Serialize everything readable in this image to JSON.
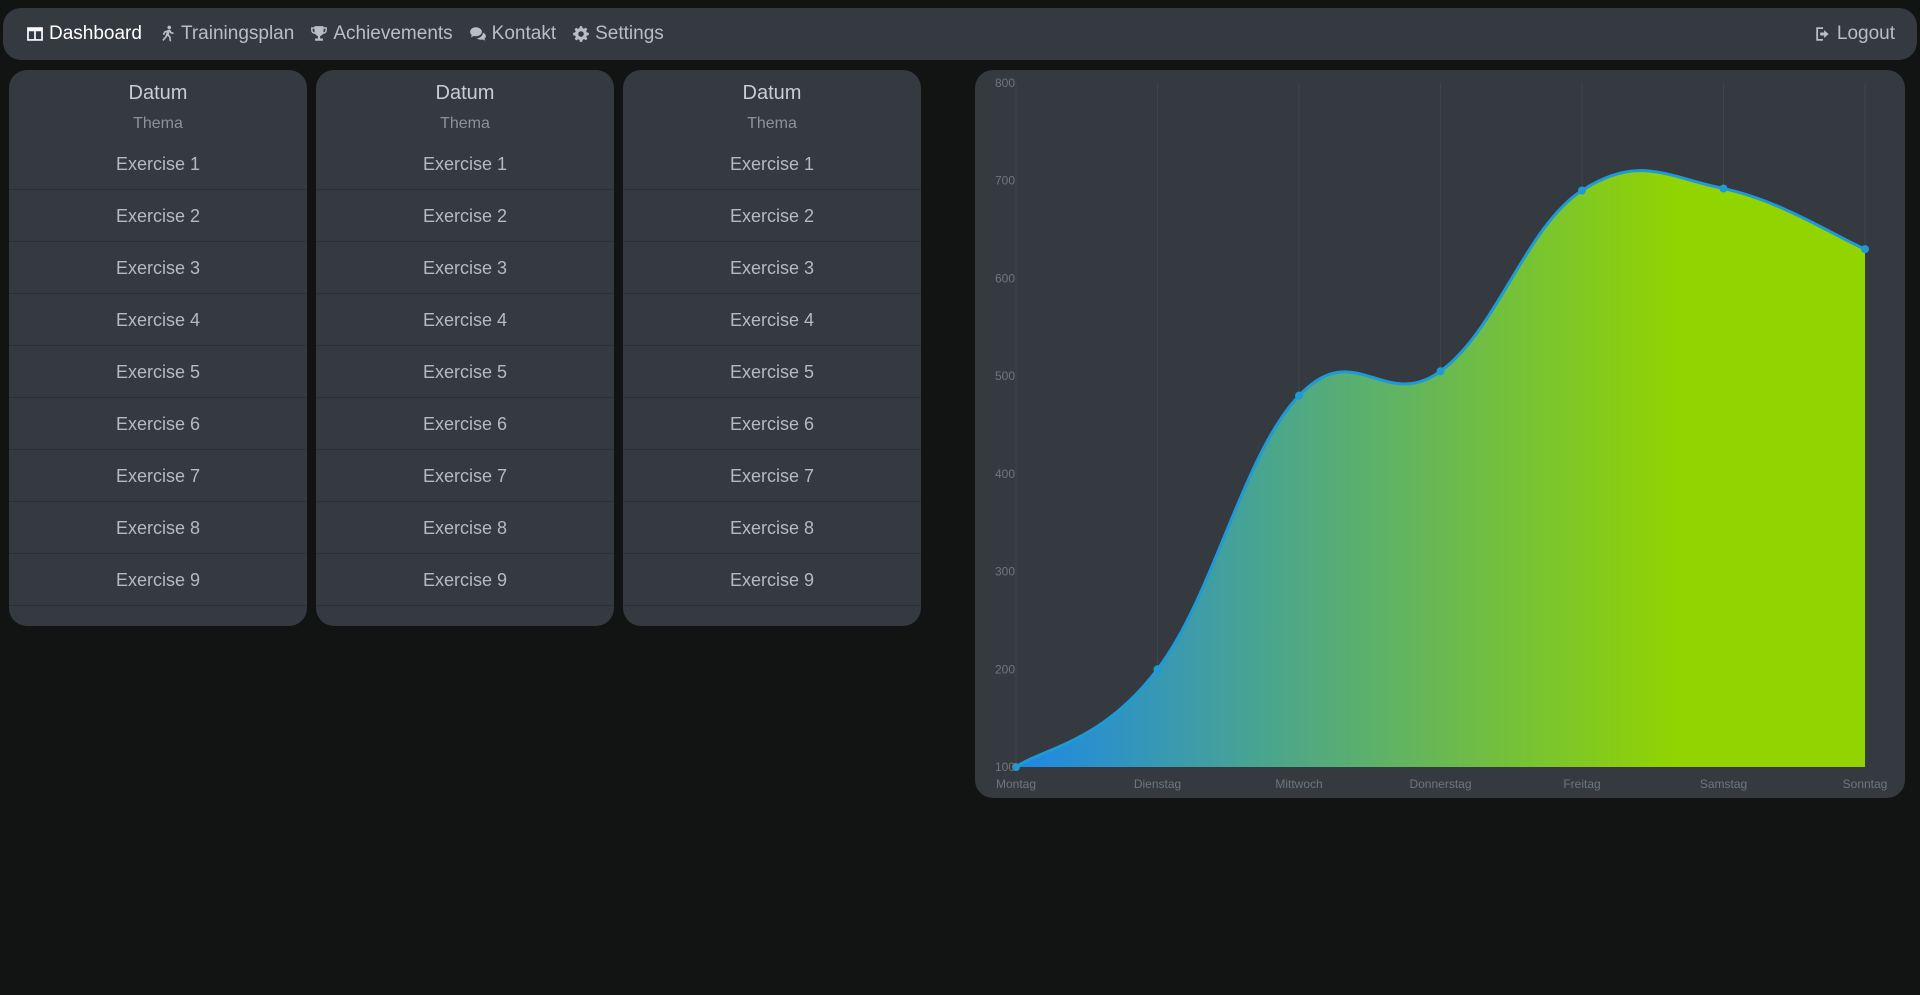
{
  "nav": {
    "items": [
      {
        "label": "Dashboard",
        "icon": "table-icon",
        "active": true
      },
      {
        "label": "Trainingsplan",
        "icon": "running-icon",
        "active": false
      },
      {
        "label": "Achievements",
        "icon": "trophy-icon",
        "active": false
      },
      {
        "label": "Kontakt",
        "icon": "comments-icon",
        "active": false
      },
      {
        "label": "Settings",
        "icon": "gear-icon",
        "active": false
      }
    ],
    "logout": {
      "label": "Logout",
      "icon": "logout-icon"
    }
  },
  "cards": [
    {
      "date": "Datum",
      "topic": "Thema",
      "exercises": [
        "Exercise 1",
        "Exercise 2",
        "Exercise 3",
        "Exercise 4",
        "Exercise 5",
        "Exercise 6",
        "Exercise 7",
        "Exercise 8",
        "Exercise 9"
      ]
    },
    {
      "date": "Datum",
      "topic": "Thema",
      "exercises": [
        "Exercise 1",
        "Exercise 2",
        "Exercise 3",
        "Exercise 4",
        "Exercise 5",
        "Exercise 6",
        "Exercise 7",
        "Exercise 8",
        "Exercise 9"
      ]
    },
    {
      "date": "Datum",
      "topic": "Thema",
      "exercises": [
        "Exercise 1",
        "Exercise 2",
        "Exercise 3",
        "Exercise 4",
        "Exercise 5",
        "Exercise 6",
        "Exercise 7",
        "Exercise 8",
        "Exercise 9"
      ]
    }
  ],
  "colors": {
    "line": "#1e9ad6",
    "gradient_start": "#1e88e5",
    "gradient_end": "#92d400"
  },
  "chart_data": {
    "type": "area",
    "categories": [
      "Montag",
      "Dienstag",
      "Mittwoch",
      "Donnerstag",
      "Freitag",
      "Samstag",
      "Sonntag"
    ],
    "series": [
      {
        "values": [
          100,
          200,
          480,
          505,
          690,
          692,
          630
        ]
      }
    ],
    "title": "",
    "xlabel": "",
    "ylabel": "",
    "ylim": [
      100,
      800
    ],
    "yticks": [
      100,
      200,
      300,
      400,
      500,
      600,
      700,
      800
    ],
    "smooth": true,
    "grid": "vertical",
    "legend": "none"
  }
}
